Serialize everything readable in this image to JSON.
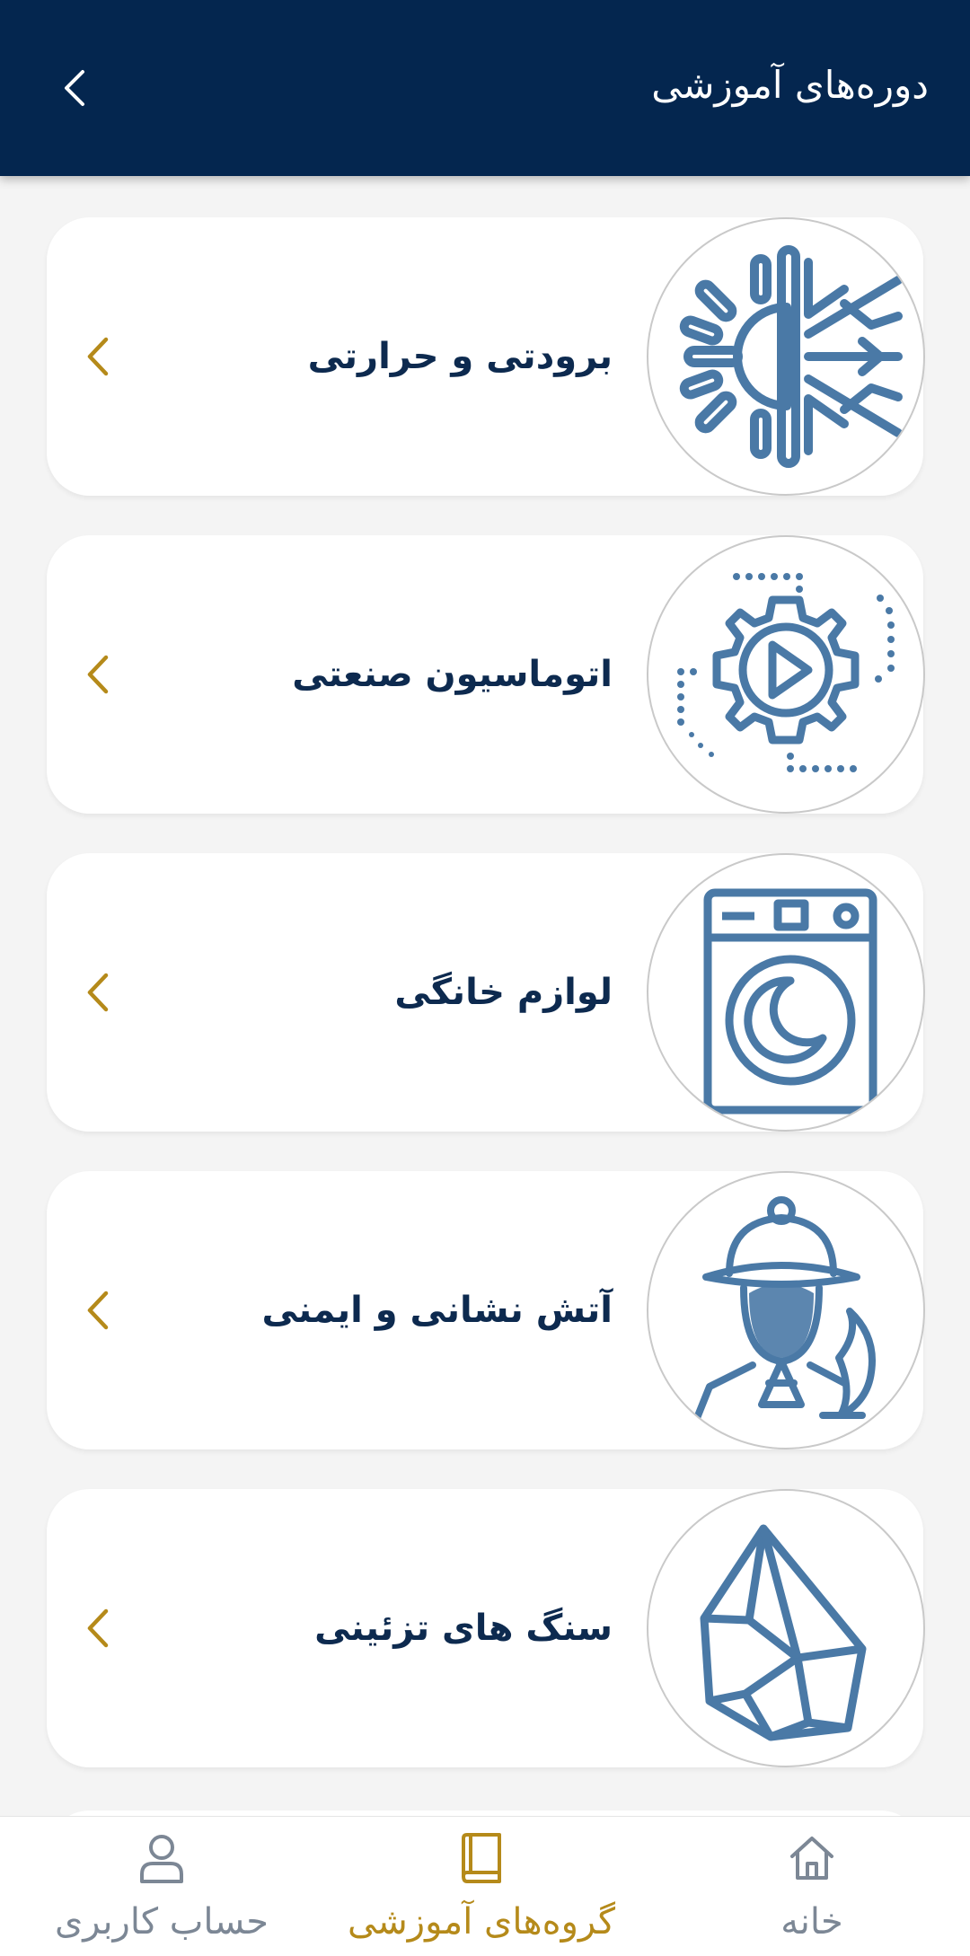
{
  "header": {
    "title": "دوره‌های آموزشی"
  },
  "categories": [
    {
      "label": "برودتی و حرارتی",
      "icon": "sun-snowflake-icon"
    },
    {
      "label": "اتوماسیون صنعتی",
      "icon": "gear-play-icon"
    },
    {
      "label": "لوازم خانگی",
      "icon": "washing-machine-icon"
    },
    {
      "label": "آتش نشانی و ایمنی",
      "icon": "firefighter-icon"
    },
    {
      "label": "سنگ های تزئینی",
      "icon": "gemstone-icon"
    }
  ],
  "bottom_nav": {
    "home": "خانه",
    "courses": "گروه‌های آموزشی",
    "account": "حساب کاربری",
    "active": "courses"
  },
  "colors": {
    "header_bg": "#04264f",
    "accent": "#b58a1a",
    "icon_blue": "#4a79a6",
    "text_dark": "#0d2a4f"
  }
}
